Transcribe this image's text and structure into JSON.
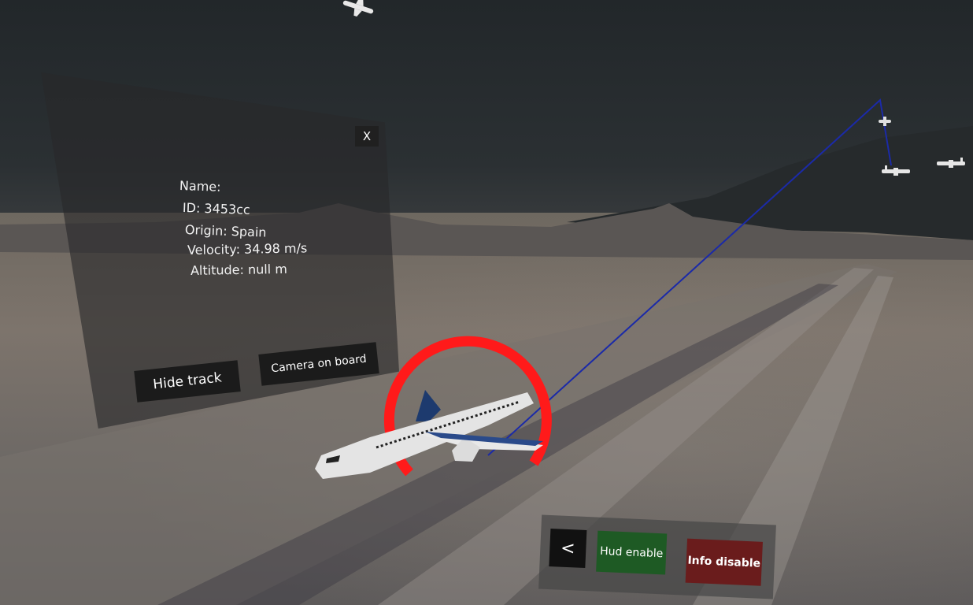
{
  "info_panel": {
    "close_label": "X",
    "name_line": "Name:",
    "id_line": "ID: 3453cc",
    "origin_line": "Origin: Spain",
    "velocity_line": "Velocity: 34.98 m/s",
    "altitude_line": "Altitude: null m",
    "hide_track_label": "Hide track",
    "camera_label": "Camera on board"
  },
  "controls": {
    "back_label": "<",
    "hud_label": "Hud enable",
    "info_label": "Info disable"
  },
  "colors": {
    "selection_ring": "#ff1a1a",
    "track_line": "#1b2aa8",
    "hud_button": "#1e5a24",
    "info_button": "#6a1c1c"
  },
  "icons": [
    "airplane-icon",
    "selection-ring-icon"
  ]
}
